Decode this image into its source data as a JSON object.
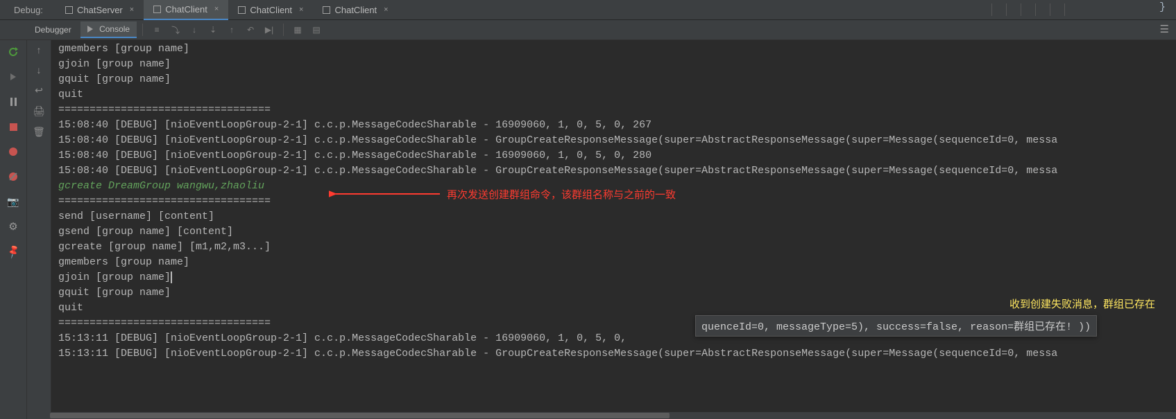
{
  "debug": {
    "label": "Debug:",
    "tabs": [
      {
        "label": "ChatServer",
        "close": "×",
        "active": false
      },
      {
        "label": "ChatClient",
        "close": "×",
        "active": true
      },
      {
        "label": "ChatClient",
        "close": "×",
        "active": false
      },
      {
        "label": "ChatClient",
        "close": "×",
        "active": false
      }
    ],
    "right_brace": "}"
  },
  "toolbar": {
    "debugger_tab": "Debugger",
    "console_tab": "Console"
  },
  "left_icons": {
    "rerun_title": "Rerun",
    "resume_title": "Resume",
    "pause_title": "Pause",
    "stop_title": "Stop",
    "breakpoint_title": "View Breakpoints",
    "mute_bp_title": "Mute Breakpoints",
    "camera_title": "Get Thread Dump",
    "settings_title": "Settings",
    "pin_title": "Pin Tab"
  },
  "second_icons": {
    "up": "↑",
    "down": "↓",
    "wrap": "↩",
    "print": "🖨",
    "trash": "🗑"
  },
  "console": {
    "lines": [
      "gmembers [group name]",
      "gjoin [group name]",
      "gquit [group name]",
      "quit",
      "==================================",
      "15:08:40 [DEBUG] [nioEventLoopGroup-2-1] c.c.p.MessageCodecSharable - 16909060, 1, 0, 5, 0, 267",
      "15:08:40 [DEBUG] [nioEventLoopGroup-2-1] c.c.p.MessageCodecSharable - GroupCreateResponseMessage(super=AbstractResponseMessage(super=Message(sequenceId=0, messa",
      "15:08:40 [DEBUG] [nioEventLoopGroup-2-1] c.c.p.MessageCodecSharable - 16909060, 1, 0, 5, 0, 280",
      "15:08:40 [DEBUG] [nioEventLoopGroup-2-1] c.c.p.MessageCodecSharable - GroupCreateResponseMessage(super=AbstractResponseMessage(super=Message(sequenceId=0, messa"
    ],
    "green_input": "gcreate DreamGroup wangwu,zhaoliu",
    "menu_lines": [
      "==================================",
      "send [username] [content]",
      "gsend [group name] [content]",
      "gcreate [group name] [m1,m2,m3...]",
      "gmembers [group name]"
    ],
    "cursor_line": "gjoin [group name]",
    "after_cursor_lines": [
      "gquit [group name]",
      "quit",
      "=================================="
    ],
    "tail_lines": [
      "15:13:11 [DEBUG] [nioEventLoopGroup-2-1] c.c.p.MessageCodecSharable - 16909060, 1, 0, 5, 0,",
      "15:13:11 [DEBUG] [nioEventLoopGroup-2-1] c.c.p.MessageCodecSharable - GroupCreateResponseMessage(super=AbstractResponseMessage(super=Message(sequenceId=0, messa"
    ]
  },
  "popup": {
    "text": "quenceId=0, messageType=5), success=false, reason=群组已存在! ))"
  },
  "annotations": {
    "red_text": "再次发送创建群组命令，该群组名称与之前的一致",
    "yellow_text": "收到创建失败消息，群组已存在"
  }
}
